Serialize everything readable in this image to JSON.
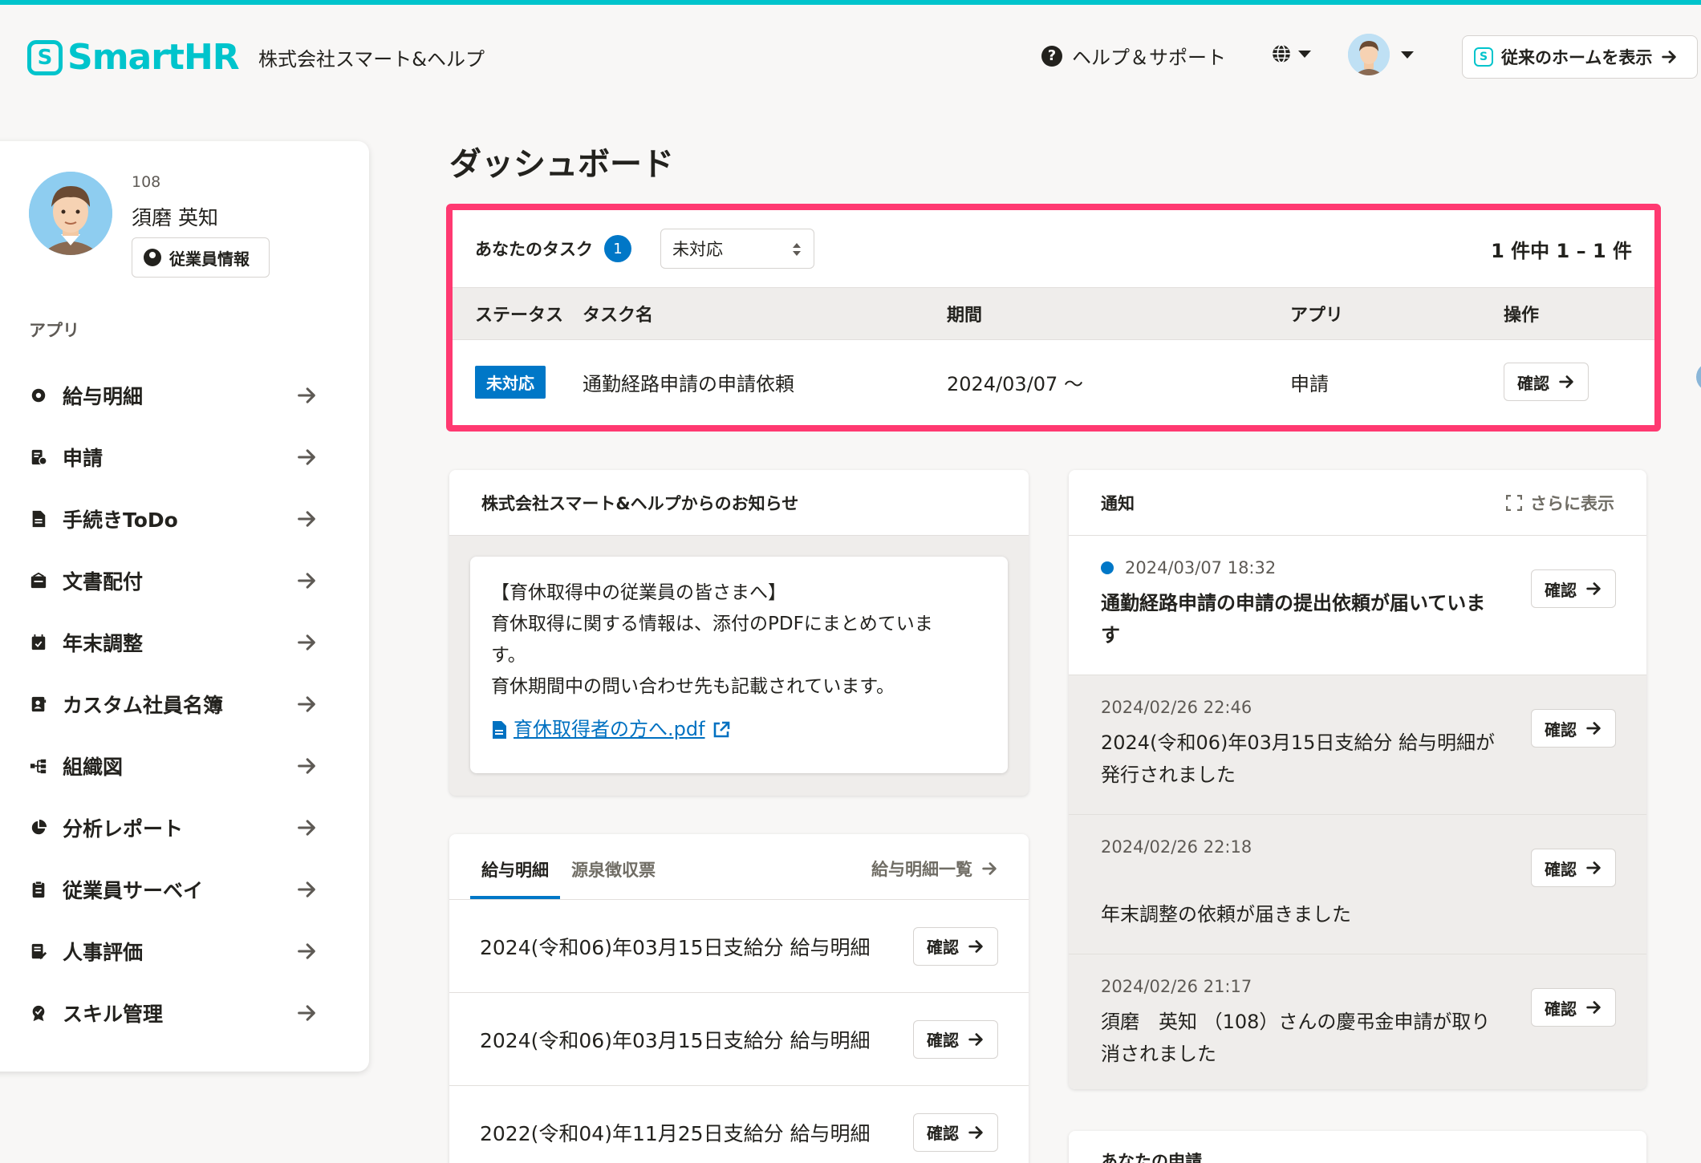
{
  "header": {
    "logo_text": "SmartHR",
    "company": "株式会社スマート&ヘルプ",
    "help_label": "ヘルプ＆サポート",
    "legacy_home_label": "従来のホームを表示"
  },
  "profile": {
    "employee_number": "108",
    "name": "須磨 英知",
    "info_button": "従業員情報"
  },
  "sidebar": {
    "section_label": "アプリ",
    "items": [
      {
        "label": "給与明細",
        "icon": "gear-badge-icon"
      },
      {
        "label": "申請",
        "icon": "form-icon"
      },
      {
        "label": "手続きToDo",
        "icon": "document-icon"
      },
      {
        "label": "文書配付",
        "icon": "inbox-icon"
      },
      {
        "label": "年末調整",
        "icon": "calendar-icon"
      },
      {
        "label": "カスタム社員名簿",
        "icon": "contact-book-icon"
      },
      {
        "label": "組織図",
        "icon": "org-chart-icon"
      },
      {
        "label": "分析レポート",
        "icon": "pie-chart-icon"
      },
      {
        "label": "従業員サーベイ",
        "icon": "clipboard-icon"
      },
      {
        "label": "人事評価",
        "icon": "evaluation-icon"
      },
      {
        "label": "スキル管理",
        "icon": "skill-badge-icon"
      }
    ]
  },
  "main": {
    "page_title": "ダッシュボード"
  },
  "tasks": {
    "title": "あなたのタスク",
    "count": "1",
    "filter_value": "未対応",
    "pager": "1 件中 1 – 1 件",
    "columns": [
      "ステータス",
      "タスク名",
      "期間",
      "アプリ",
      "操作"
    ],
    "rows": [
      {
        "status": "未対応",
        "name": "通勤経路申請の申請依頼",
        "period": "2024/03/07 〜",
        "app": "申請",
        "action": "確認"
      }
    ]
  },
  "notice": {
    "title": "株式会社スマート&ヘルプからのお知らせ",
    "lines": [
      "【育休取得中の従業員の皆さまへ】",
      "育休取得に関する情報は、添付のPDFにまとめていま",
      "す。",
      "育休期間中の問い合わせ先も記載されています。"
    ],
    "attachment": "育休取得者の方へ.pdf"
  },
  "payslips": {
    "tabs": [
      "給与明細",
      "源泉徴収票"
    ],
    "more_label": "給与明細一覧",
    "rows": [
      {
        "label": "2024(令和06)年03月15日支給分 給与明細",
        "action": "確認"
      },
      {
        "label": "2024(令和06)年03月15日支給分 給与明細",
        "action": "確認"
      },
      {
        "label": "2022(令和04)年11月25日支給分 給与明細",
        "action": "確認"
      }
    ]
  },
  "notifications": {
    "title": "通知",
    "more_label": "さらに表示",
    "items": [
      {
        "date": "2024/03/07 18:32",
        "text": "通勤経路申請の申請の提出依頼が届いていま",
        "text2": "す",
        "unread": true,
        "action": "確認"
      },
      {
        "date": "2024/02/26 22:46",
        "text": "2024(令和06)年03月15日支給分 給与明細が",
        "text2": "発行されました",
        "unread": false,
        "action": "確認"
      },
      {
        "date": "2024/02/26 22:18",
        "text": "",
        "text2": "年末調整の依頼が届きました",
        "unread": false,
        "action": "確認"
      },
      {
        "date": "2024/02/26 21:17",
        "text": "須磨　英知 （108）さんの慶弔金申請が取り",
        "text2": "消されました",
        "unread": false,
        "action": "確認"
      }
    ]
  },
  "requests": {
    "title": "あなたの申請"
  },
  "colors": {
    "brand": "#00c4cc",
    "highlight": "#ff3971",
    "primary": "#0077c7"
  }
}
